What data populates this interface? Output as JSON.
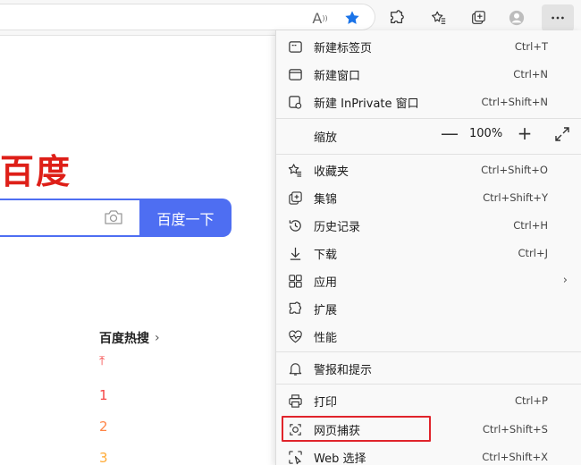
{
  "toolbar": {
    "read_aloud_label": "A",
    "read_aloud_sup": "))",
    "icons": [
      "read-aloud-icon",
      "favorite-star-icon",
      "extensions-icon",
      "favorites-icon",
      "collections-icon",
      "profile-icon",
      "more-icon"
    ],
    "accent_color": "#1a73e8"
  },
  "page": {
    "logo": "百度",
    "search_button": "百度一下",
    "hot_title": "百度热搜",
    "hot_arrow": "›",
    "ranks": [
      "⤒",
      "1",
      "2",
      "3"
    ],
    "brand_color": "#4e6ef2",
    "logo_color": "#de1f18"
  },
  "menu": {
    "items": [
      {
        "label": "新建标签页",
        "shortcut": "Ctrl+T"
      },
      {
        "label": "新建窗口",
        "shortcut": "Ctrl+N"
      },
      {
        "label": "新建 InPrivate 窗口",
        "shortcut": "Ctrl+Shift+N"
      },
      {
        "label": "缩放",
        "shortcut": ""
      },
      {
        "label": "收藏夹",
        "shortcut": "Ctrl+Shift+O"
      },
      {
        "label": "集锦",
        "shortcut": "Ctrl+Shift+Y"
      },
      {
        "label": "历史记录",
        "shortcut": "Ctrl+H"
      },
      {
        "label": "下载",
        "shortcut": "Ctrl+J"
      },
      {
        "label": "应用",
        "shortcut": ""
      },
      {
        "label": "扩展",
        "shortcut": ""
      },
      {
        "label": "性能",
        "shortcut": ""
      },
      {
        "label": "警报和提示",
        "shortcut": ""
      },
      {
        "label": "打印",
        "shortcut": "Ctrl+P"
      },
      {
        "label": "网页捕获",
        "shortcut": "Ctrl+Shift+S"
      },
      {
        "label": "Web 选择",
        "shortcut": "Ctrl+Shift+X"
      }
    ],
    "zoom": {
      "minus": "—",
      "value": "100%",
      "plus": "+"
    },
    "apps_chevron": "›",
    "highlight_color": "#e0242b"
  }
}
